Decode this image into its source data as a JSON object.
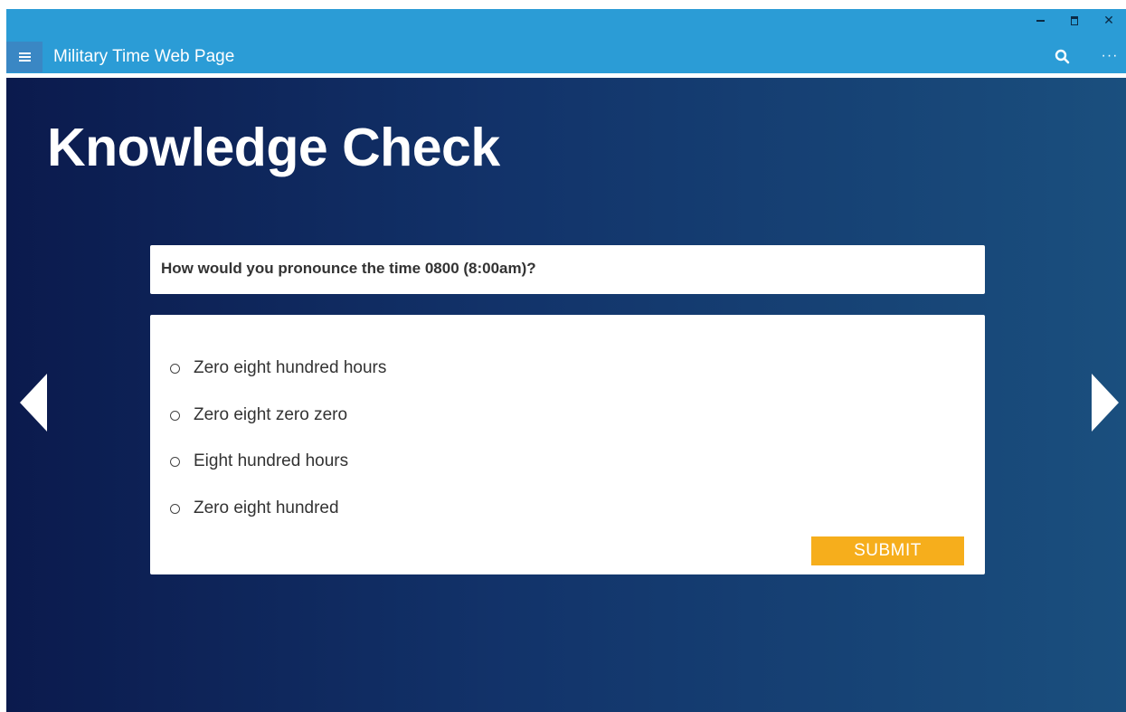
{
  "window": {
    "title": "Military Time Web Page",
    "controls": [
      "minimize",
      "maximize",
      "close"
    ]
  },
  "toolbar": {
    "menu_icon": "hamburger-icon",
    "search_icon": "search-icon",
    "more_label": "···"
  },
  "colors": {
    "titlebar": "#2b9cd6",
    "accent_button": "#f6ae1c",
    "background_start": "#0b1a4d",
    "background_end": "#1a4f7e"
  },
  "page": {
    "heading": "Knowledge Check",
    "question": "How would you pronounce the time 0800 (8:00am)?",
    "options": [
      "Zero eight hundred hours",
      "Zero eight zero zero",
      "Eight hundred hours",
      "Zero eight hundred"
    ],
    "submit_label": "SUBMIT"
  },
  "navigation": {
    "prev_icon": "left-arrow-icon",
    "next_icon": "right-arrow-icon"
  }
}
